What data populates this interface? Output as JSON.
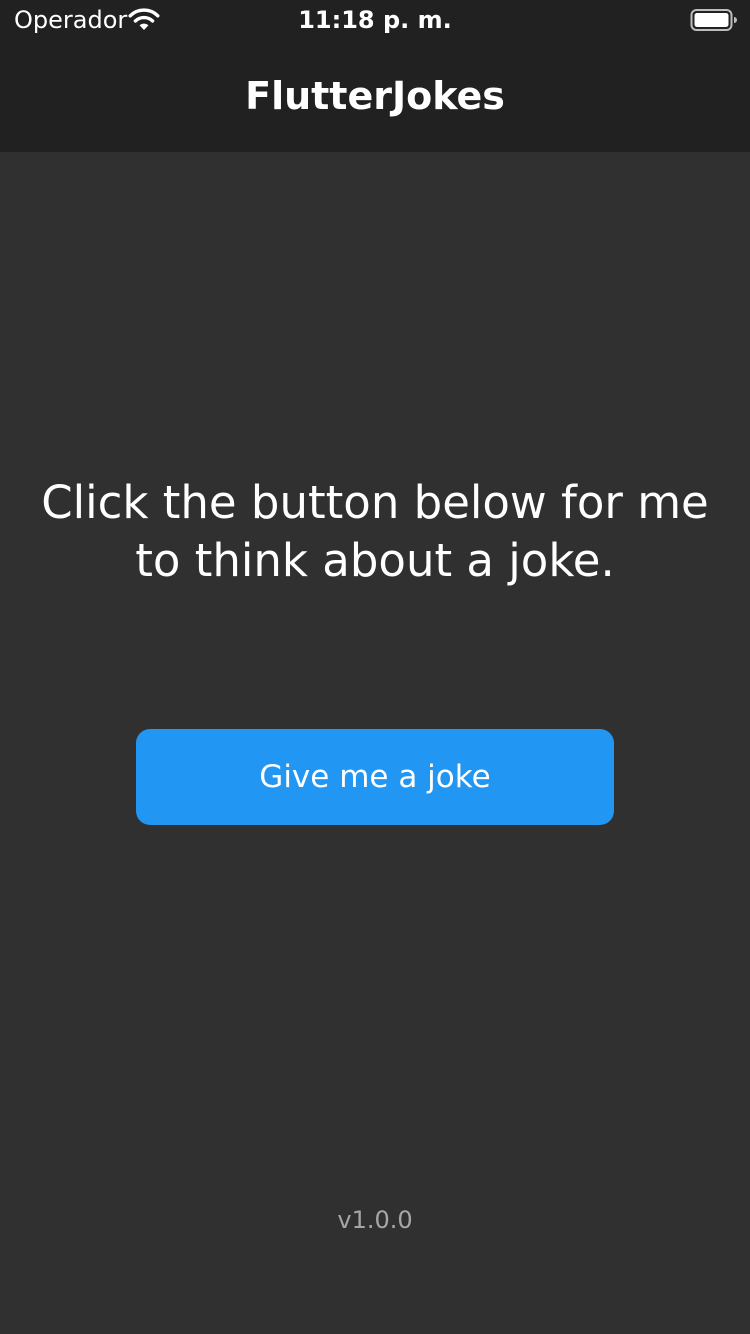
{
  "status_bar": {
    "carrier": "Operador",
    "time": "11:18 p. m.",
    "wifi_icon": "wifi-icon",
    "battery_icon": "battery-full-icon"
  },
  "app_bar": {
    "title": "FlutterJokes"
  },
  "main": {
    "prompt": "Click the button below for me to think about a joke.",
    "button_label": "Give me a joke",
    "version": "v1.0.0"
  },
  "colors": {
    "background": "#303030",
    "app_bar": "#212121",
    "accent": "#2196F3",
    "version_text": "#a6a6a6"
  }
}
